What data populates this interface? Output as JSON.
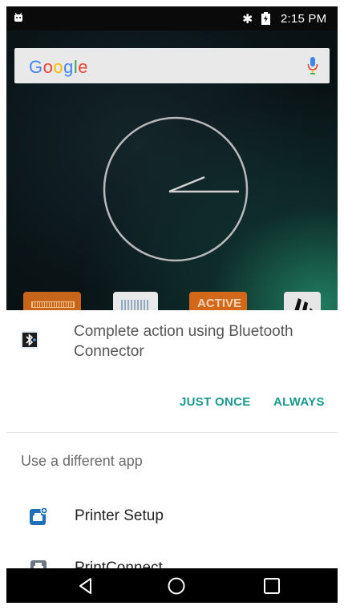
{
  "status_bar": {
    "time": "2:15 PM",
    "icons": [
      "android-icon",
      "bluetooth-icon",
      "battery-charging-icon"
    ]
  },
  "search": {
    "logo_text": [
      "G",
      "o",
      "o",
      "g",
      "l",
      "e"
    ],
    "icons": [
      "mic-icon"
    ]
  },
  "home_icons": [
    {
      "name": "barcode-app-icon",
      "label": ""
    },
    {
      "name": "scanner-app-icon",
      "label": ""
    },
    {
      "name": "active-app-icon",
      "label": "ACTIVE"
    },
    {
      "name": "zebra-app-icon",
      "label": ""
    }
  ],
  "dialog": {
    "title": "Complete action using Bluetooth Connector",
    "title_icon": "bluetooth-connector-icon",
    "just_once_label": "JUST ONCE",
    "always_label": "ALWAYS",
    "different_app_label": "Use a different app",
    "apps": [
      {
        "name": "Printer Setup",
        "icon": "printer-setup-icon"
      },
      {
        "name": "PrintConnect",
        "icon": "printconnect-icon"
      }
    ]
  },
  "nav_bar": {
    "icons": [
      "back-icon",
      "home-icon",
      "recents-icon"
    ]
  },
  "colors": {
    "accent": "#1a9a8c",
    "status_bar": "#0a0a0a",
    "nav_bar": "#000000",
    "dialog_bg": "#ffffff"
  }
}
